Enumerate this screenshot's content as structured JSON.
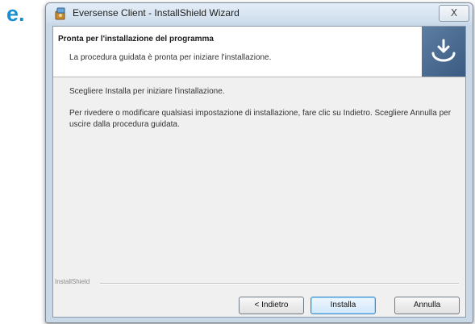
{
  "step_marker": "e.",
  "window": {
    "title": "Eversense Client - InstallShield Wizard",
    "close_symbol": "X"
  },
  "header": {
    "title": "Pronta per l'installazione del programma",
    "subtitle": "La procedura guidata è pronta per iniziare l'installazione."
  },
  "body": {
    "line1": "Scegliere Installa per iniziare l'installazione.",
    "line2": "Per rivedere o modificare qualsiasi impostazione di installazione, fare clic su Indietro. Scegliere Annulla per uscire dalla procedura guidata."
  },
  "footer": {
    "brand": "InstallShield"
  },
  "buttons": {
    "back": "< Indietro",
    "install": "Installa",
    "cancel": "Annulla"
  },
  "colors": {
    "step_marker": "#1a8fd0",
    "header_graphic": "#4a6b93",
    "default_button_border": "#3a8ecf"
  },
  "icons": {
    "app": "installer-icon",
    "header": "install-arrow-icon",
    "close": "close-icon"
  }
}
